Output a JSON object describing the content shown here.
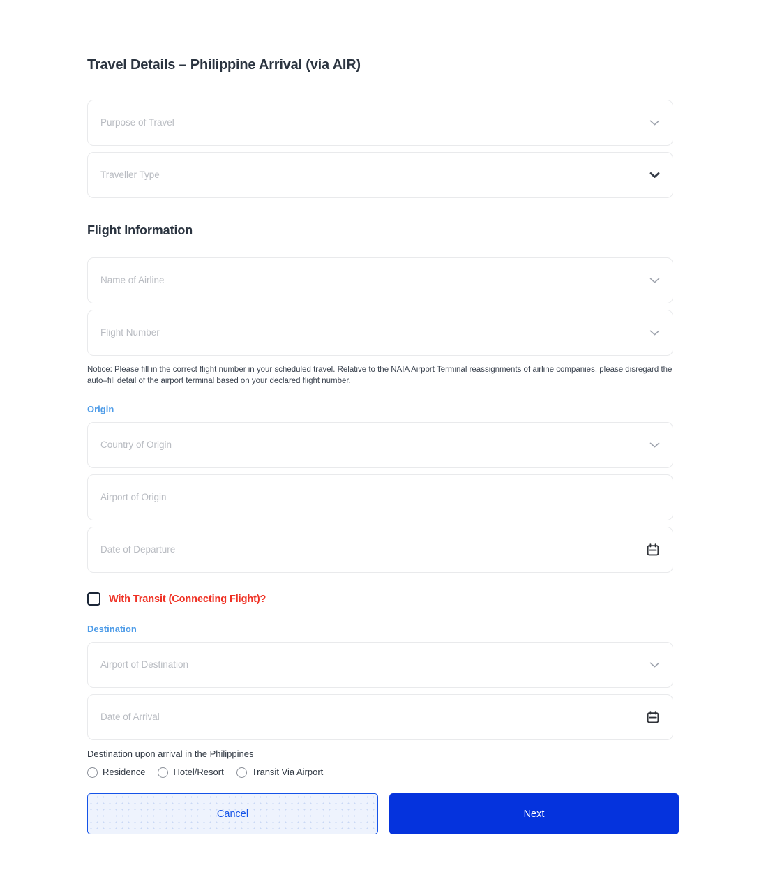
{
  "page": {
    "title": "Travel Details – Philippine Arrival (via AIR)"
  },
  "travel_details": {
    "fields": [
      {
        "label": "Purpose of Travel",
        "icon": "chevron-down-icon"
      },
      {
        "label": "Traveller Type",
        "icon": "chevron-down-icon"
      }
    ]
  },
  "flight_information": {
    "heading": "Flight Information",
    "fields": [
      {
        "label": "Name of Airline",
        "icon": "chevron-down-icon"
      },
      {
        "label": "Flight Number",
        "icon": "chevron-down-icon"
      }
    ],
    "notice": "Notice: Please fill in the correct flight number in your scheduled travel. Relative to the NAIA Airport Terminal reassignments of airline companies, please disregard the auto–fill detail of the airport terminal based on your declared flight number."
  },
  "origin": {
    "label": "Origin",
    "fields": [
      {
        "label": "Country of Origin",
        "icon": "chevron-down-icon"
      },
      {
        "label": "Airport of Origin",
        "icon": "none"
      },
      {
        "label": "Date of Departure",
        "icon": "calendar-icon"
      }
    ]
  },
  "transit": {
    "label": "With Transit (Connecting Flight)?",
    "checked": false
  },
  "destination": {
    "label": "Destination",
    "fields": [
      {
        "label": "Airport of Destination",
        "icon": "chevron-down-icon"
      },
      {
        "label": "Date of Arrival",
        "icon": "calendar-icon"
      }
    ],
    "arrival_caption": "Destination upon arrival in the Philippines",
    "arrival_options": [
      {
        "label": "Residence",
        "selected": false
      },
      {
        "label": "Hotel/Resort",
        "selected": false
      },
      {
        "label": "Transit Via Airport",
        "selected": false
      }
    ]
  },
  "actions": {
    "cancel_label": "Cancel",
    "next_label": "Next"
  },
  "colors": {
    "accent_blue": "#0533dd",
    "sub_label_blue": "#4e9ce8",
    "transit_red": "#ef3124",
    "cancel_text": "#1453e8",
    "field_border": "#e9eaec",
    "placeholder": "#b9bcc2"
  }
}
